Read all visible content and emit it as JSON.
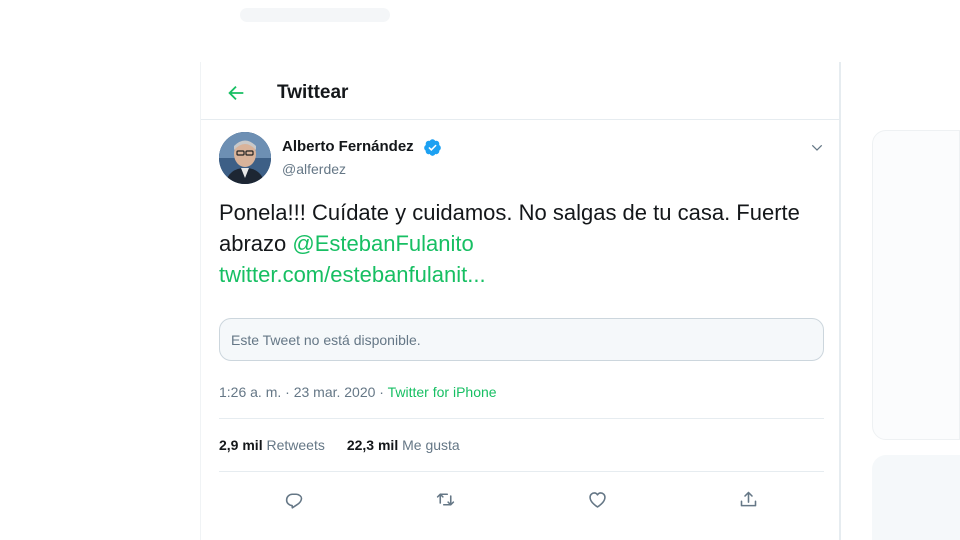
{
  "header": {
    "title": "Twittear",
    "back_icon": "arrow-left-icon"
  },
  "tweet": {
    "author": {
      "name": "Alberto Fernández",
      "handle": "@alferdez",
      "verified": true,
      "avatar_icon": "avatar"
    },
    "text_plain": "Ponela!!! Cuídate y cuidamos. No salgas de tu casa. Fuerte abrazo ",
    "mention": "@EstebanFulanito",
    "link": "twitter.com/estebanfulanit...",
    "quoted_unavailable": "Este Tweet no está disponible.",
    "timestamp": "1:26 a. m. · 23 mar. 2020 · ",
    "source": "Twitter for iPhone",
    "stats": {
      "retweets_count": "2,9 mil",
      "retweets_label": "Retweets",
      "likes_count": "22,3 mil",
      "likes_label": "Me gusta"
    },
    "actions": [
      "reply-icon",
      "retweet-icon",
      "like-icon",
      "share-icon"
    ]
  },
  "colors": {
    "accent": "#17bf63",
    "text": "#14171a",
    "secondary": "#657786",
    "border": "#e6ecf0",
    "verified": "#1da1f2"
  }
}
